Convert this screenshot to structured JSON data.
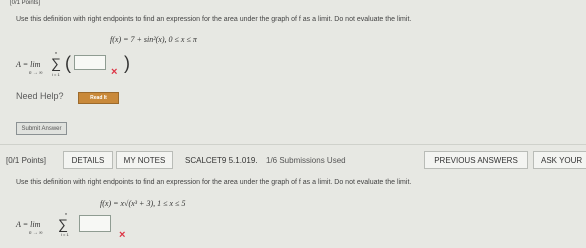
{
  "top_cut_label": "[0/1 Points]",
  "q1": {
    "prompt": "Use this definition with right endpoints to find an expression for the area under the graph of f as a limit. Do not evaluate the limit.",
    "function": "f(x) = 7 + sin²(x),   0 ≤ x ≤ π",
    "limit_prefix": "A = lim",
    "lim_sub": "n → ∞",
    "sigma": "∑",
    "sigma_sub": "i = 1",
    "sigma_sup": "n",
    "open_paren": "(",
    "close_paren": ")",
    "answer_value": "",
    "wrong_mark": "×",
    "need_help": "Need Help?",
    "read_it": "Read It",
    "submit": "Submit Answer"
  },
  "q2": {
    "points": "[0/1 Points]",
    "tabs": {
      "details": "DETAILS",
      "notes": "MY NOTES",
      "ref": "SCALCET9 5.1.019.",
      "subs": "1/6 Submissions Used",
      "prev": "PREVIOUS ANSWERS",
      "ask": "ASK YOUR"
    },
    "prompt": "Use this definition with right endpoints to find an expression for the area under the graph of f as a limit. Do not evaluate the limit.",
    "function": "f(x) = x√(x³ + 3),   1 ≤ x ≤ 5",
    "limit_prefix": "A = lim",
    "lim_sub": "n → ∞",
    "sigma": "∑",
    "sigma_sub": "i = 1",
    "sigma_sup": "n",
    "answer_value": "",
    "wrong_mark": "×"
  }
}
